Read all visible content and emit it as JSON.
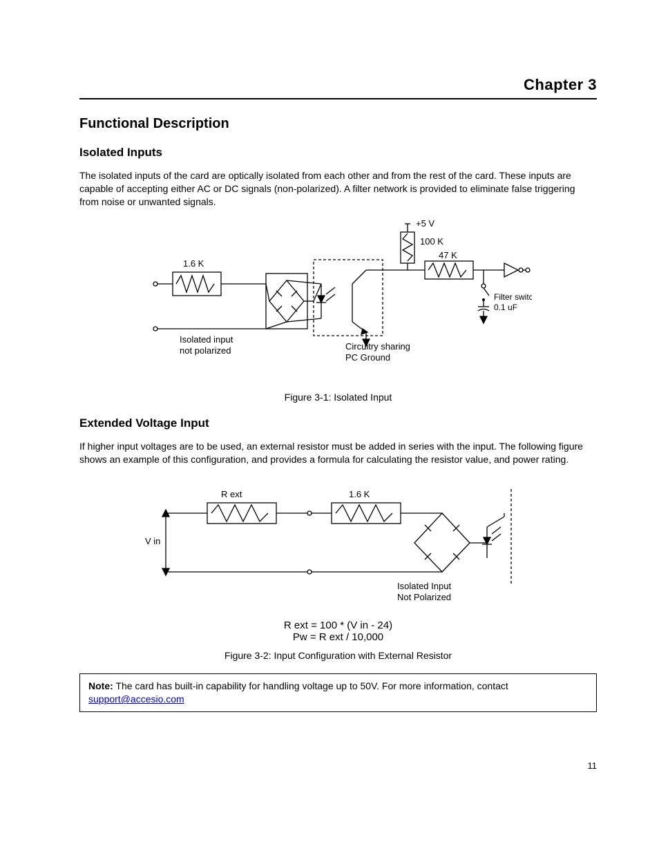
{
  "header": {
    "chapter": "Chapter 3"
  },
  "section1": {
    "title": "Functional Description",
    "sub_title": "Isolated Inputs",
    "para1": "The isolated inputs of the card are optically isolated from each other and from the rest of the card. These inputs are capable of accepting either AC or DC signals (non-polarized). A filter network is provided to eliminate false triggering from noise or unwanted signals.",
    "fig1_caption": "Figure 3-1: Isolated Input",
    "fig1_labels": {
      "r_in": "1.6 K",
      "plus5v": "+5 V",
      "r_pull": "100 K",
      "r_ser": "47 K",
      "iso_line1": "Isolated input",
      "iso_line2": "not polarized",
      "pcg_line1": "Circuitry sharing",
      "pcg_line2": "PC Ground",
      "fsw_line1": "Filter switch",
      "fsw_line2": "0.1 uF"
    }
  },
  "section2": {
    "sub_title": "Extended Voltage Input",
    "para": "If higher input voltages are to be used, an external resistor must be added in series with the input. The following figure shows an example of this configuration, and provides a formula for calculating the resistor value, and power rating.",
    "fig2_caption": "Figure 3-2: Input Configuration with External Resistor",
    "fig2_labels": {
      "rext": "R ext",
      "r16": "1.6 K",
      "vin": "V in",
      "iso_line1": "Isolated Input",
      "iso_line2": "Not Polarized",
      "eq1": "R ext = 100 * (V in - 24)",
      "eq2": "Pw = R ext / 10,000"
    }
  },
  "note": {
    "lead": "Note:",
    "text_before_link": " The card has built-in capability for handling voltage up to 50V. For more information, contact ",
    "link_text": "support@accesio.com",
    "text_after": ""
  },
  "page_num": "11"
}
